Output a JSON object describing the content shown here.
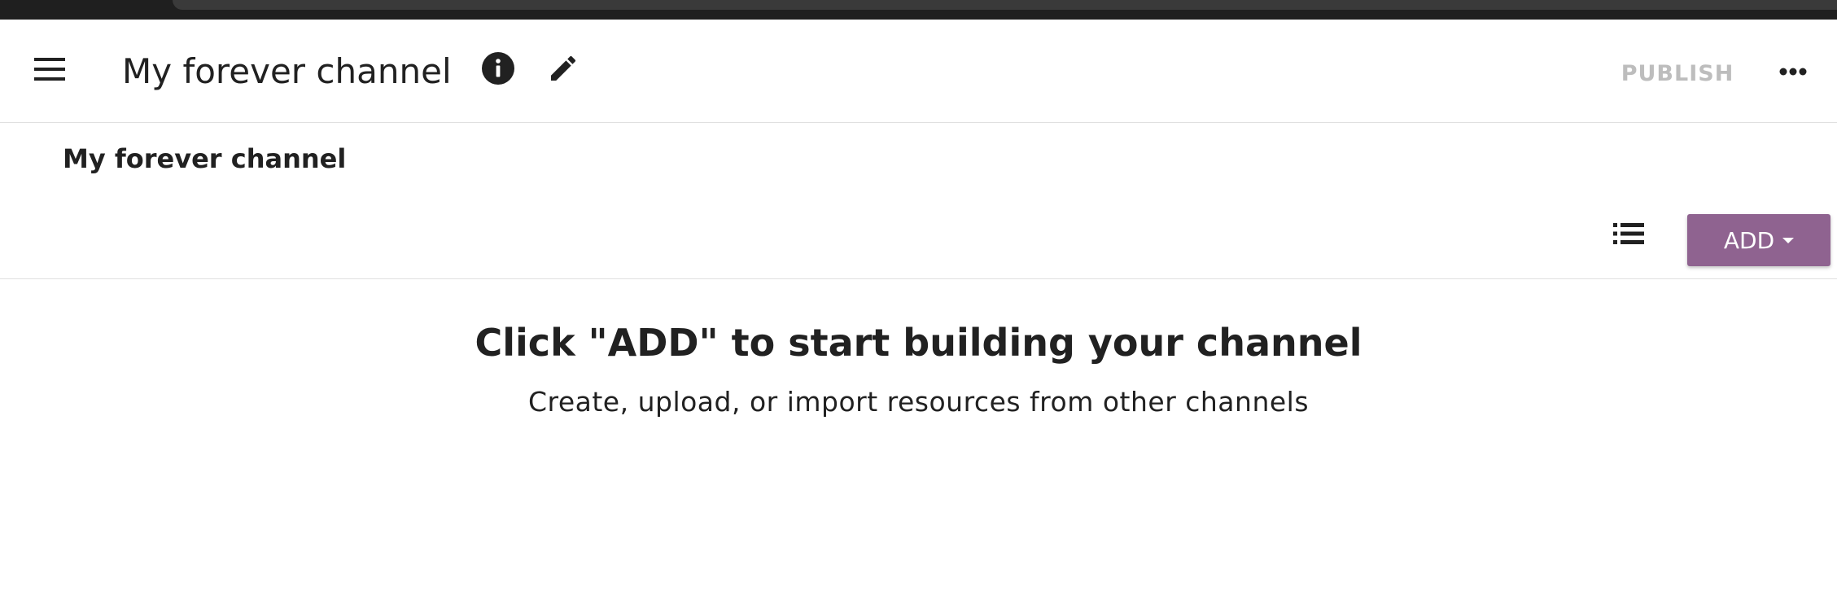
{
  "header": {
    "title": "My forever channel",
    "publish_label": "PUBLISH",
    "icons": {
      "menu": "menu-icon",
      "info": "info-icon",
      "edit": "pencil-icon",
      "more": "more-horizontal-icon"
    }
  },
  "breadcrumb": {
    "current": "My forever channel"
  },
  "toolbar": {
    "list_view_icon": "list-view-icon",
    "add_label": "ADD"
  },
  "empty_state": {
    "title": "Click \"ADD\" to start building your channel",
    "subtitle": "Create, upload, or import resources from other channels"
  },
  "colors": {
    "accent": "#8f6390",
    "text": "#212121",
    "publish_disabled": "#bdbdbd",
    "divider": "#e0e0e0"
  }
}
